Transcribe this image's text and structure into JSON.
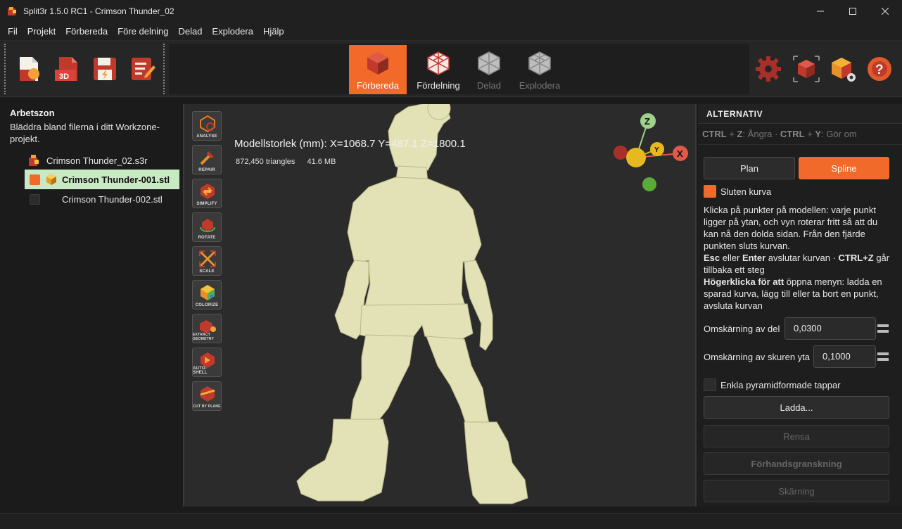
{
  "window": {
    "title": "Split3r 1.5.0 RC1 - Crimson Thunder_02"
  },
  "menu": [
    "Fil",
    "Projekt",
    "Förbereda",
    "Före delning",
    "Delad",
    "Explodera",
    "Hjälp"
  ],
  "toolbar": {
    "modes": [
      {
        "label": "Förbereda",
        "state": "active"
      },
      {
        "label": "Fördelning",
        "state": "normal"
      },
      {
        "label": "Delad",
        "state": "disabled"
      },
      {
        "label": "Explodera",
        "state": "disabled"
      }
    ]
  },
  "workzone": {
    "title": "Arbetszon",
    "description": "Bläddra bland filerna i ditt Workzone-projekt.",
    "project_file": "Crimson Thunder_02.s3r",
    "files": [
      {
        "name": "Crimson Thunder-001.stl",
        "selected": true,
        "color": "#f26a2a"
      },
      {
        "name": "Crimson Thunder-002.stl",
        "selected": false,
        "color": "#2a2a2a"
      }
    ]
  },
  "viewport": {
    "model_size": "Modellstorlek (mm): X=1068.7 Y=487.1 Z=1800.1",
    "triangles": "872,450 triangles",
    "file_size": "41.6 MB",
    "tools": [
      "ANALYSE",
      "REPAIR",
      "SIMPLIFY",
      "ROTATE",
      "SCALE",
      "COLORIZE",
      "EXTRACT GEOMETRY",
      "AUTO-SHELL",
      "CUT BY PLANE"
    ],
    "gizmo": {
      "z": "Z",
      "y": "Y",
      "x": "X"
    }
  },
  "options": {
    "header": "ALTERNATIV",
    "hint_ctrl1": "CTRL",
    "hint_plus1": " + ",
    "hint_z": "Z",
    "hint_undo": ": Ångra · ",
    "hint_ctrl2": "CTRL",
    "hint_plus2": " + ",
    "hint_y": "Y",
    "hint_redo": ": Gör om",
    "tab_plan": "Plan",
    "tab_spline": "Spline",
    "closed_curve_label": "Sluten kurva",
    "closed_curve_checked": true,
    "instructions_1": "Klicka på punkter på modellen: varje punkt ligger på ytan, och vyn roterar fritt så att du kan nå den dolda sidan. Från den fjärde punkten sluts kurvan.",
    "esc": "Esc",
    "or": " eller ",
    "enter": "Enter",
    "ends_curve": " avslutar kurvan · ",
    "ctrlz": "CTRL+Z",
    "goes_back": " går tillbaka ett steg",
    "rightclick": "Högerklicka för att",
    "rightclick_rest": " öppna menyn: ladda en sparad kurva, lägg till eller ta bort en punkt, avsluta kurvan",
    "trim_part_label": "Omskärning av del",
    "trim_part_value": "0,0300",
    "trim_cut_label": "Omskärning av skuren yta",
    "trim_cut_value": "0,1000",
    "simple_pyramid_label": "Enkla pyramidformade tappar",
    "btn_load": "Ladda...",
    "btn_clear": "Rensa",
    "btn_preview": "Förhandsgranskning",
    "btn_cut": "Skärning"
  },
  "colors": {
    "accent": "#f26a2a",
    "selected_row": "#c9e8c4",
    "model": "#e3e2b6"
  }
}
